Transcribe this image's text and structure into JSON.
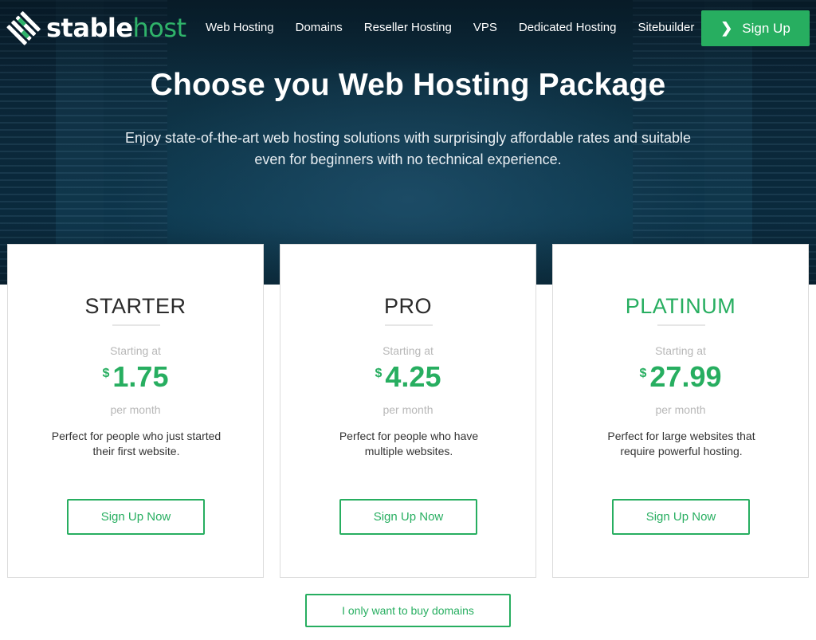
{
  "brand": {
    "logo_part1": "stable",
    "logo_part2": "host",
    "logo_icon": "stablehost-logo-icon",
    "accent_color": "#27ae60"
  },
  "nav": {
    "items": [
      {
        "label": "Web Hosting"
      },
      {
        "label": "Domains"
      },
      {
        "label": "Reseller Hosting"
      },
      {
        "label": "VPS"
      },
      {
        "label": "Dedicated Hosting"
      },
      {
        "label": "Sitebuilder"
      }
    ],
    "signup_label": "Sign Up",
    "signup_icon": "chevron-right-icon"
  },
  "hero": {
    "title": "Choose you Web Hosting Package",
    "subtitle": "Enjoy state-of-the-art web hosting solutions with surprisingly affordable rates and suitable even for beginners with no technical experience."
  },
  "plans": [
    {
      "name": "STARTER",
      "starting_label": "Starting at",
      "currency": "$",
      "price": "1.75",
      "period": "per month",
      "description": "Perfect for people who just started their first website.",
      "cta": "Sign Up Now"
    },
    {
      "name": "PRO",
      "starting_label": "Starting at",
      "currency": "$",
      "price": "4.25",
      "period": "per month",
      "description": "Perfect for people who have multiple websites.",
      "cta": "Sign Up Now"
    },
    {
      "name": "PLATINUM",
      "starting_label": "Starting at",
      "currency": "$",
      "price": "27.99",
      "period": "per month",
      "description": "Perfect for large websites that require powerful hosting.",
      "cta": "Sign Up Now"
    }
  ],
  "domains_only_label": "I only want to buy domains"
}
